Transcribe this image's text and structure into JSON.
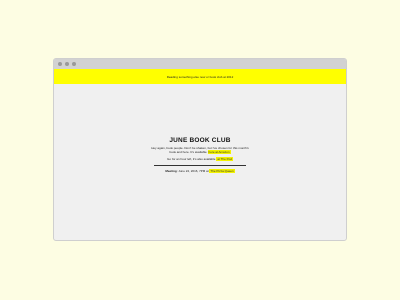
{
  "banner": {
    "text": "Reading something else now or book club at 2012"
  },
  "book_club": {
    "title": "JUNE BOOK CLUB",
    "paragraph1_text": "Hey again, book people. Don't be shaken, but I've chosen for this month's book and here. It's available",
    "paragraph1_link": "here at Amazon",
    "paragraph2_text": "Go for an hour left, it's also available",
    "paragraph2_link": "at The Pod",
    "meeting_label": "Meeting",
    "meeting_text": ": June 24, 2016, 7PM at",
    "meeting_link": "The Pizza Queen"
  }
}
